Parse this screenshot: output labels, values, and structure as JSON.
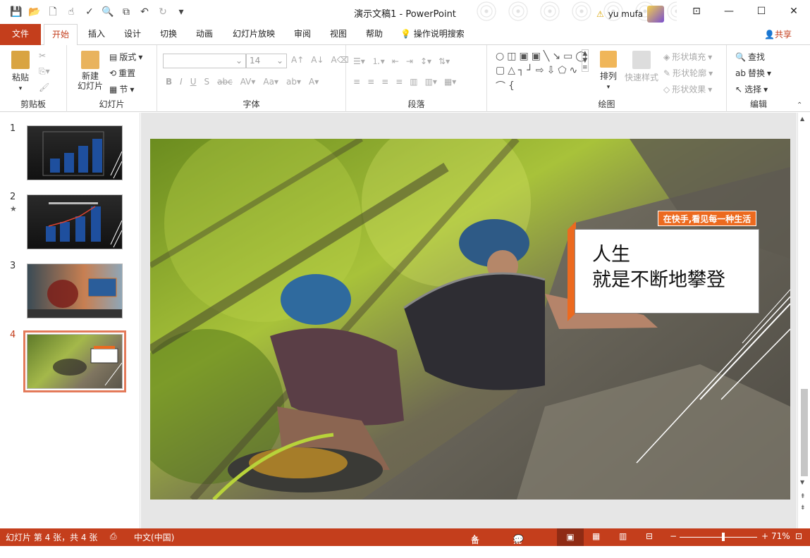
{
  "titlebar": {
    "doc_title": "演示文稿1  -  PowerPoint",
    "user_name": "yu mufa",
    "window_buttons": [
      "minimize",
      "restore",
      "maximize",
      "close"
    ]
  },
  "tabs": {
    "items": [
      "文件",
      "开始",
      "插入",
      "设计",
      "切换",
      "动画",
      "幻灯片放映",
      "审阅",
      "视图",
      "帮助",
      "操作说明搜索"
    ],
    "active": "开始",
    "share": "共享"
  },
  "ribbon": {
    "clipboard": {
      "paste": "粘贴",
      "label": "剪贴板"
    },
    "slides": {
      "new_slide": "新建\n幻灯片",
      "layout": "版式",
      "reset": "重置",
      "section": "节",
      "label": "幻灯片"
    },
    "font": {
      "font_size": "14",
      "label": "字体"
    },
    "paragraph": {
      "label": "段落"
    },
    "drawing": {
      "arrange": "排列",
      "quick_styles": "快速样式",
      "shape_fill": "形状填充",
      "shape_outline": "形状轮廓",
      "shape_effects": "形状效果",
      "label": "绘图"
    },
    "editing": {
      "find": "查找",
      "replace": "替换",
      "select": "选择",
      "label": "编辑"
    }
  },
  "thumbnails": [
    {
      "num": "1",
      "starred": false
    },
    {
      "num": "2",
      "starred": true
    },
    {
      "num": "3",
      "starred": false
    },
    {
      "num": "4",
      "starred": false
    }
  ],
  "slide": {
    "tag": "在快手,看见每一种生活",
    "line1": "人生",
    "line2": "就是不断地攀登"
  },
  "status": {
    "slide_info": "幻灯片 第 4 张，共 4 张",
    "language": "中文(中国)",
    "notes": "备注",
    "comments": "批注",
    "zoom": "71%"
  },
  "colors": {
    "accent": "#c43e1c",
    "callout_orange": "#ec6a1f"
  }
}
